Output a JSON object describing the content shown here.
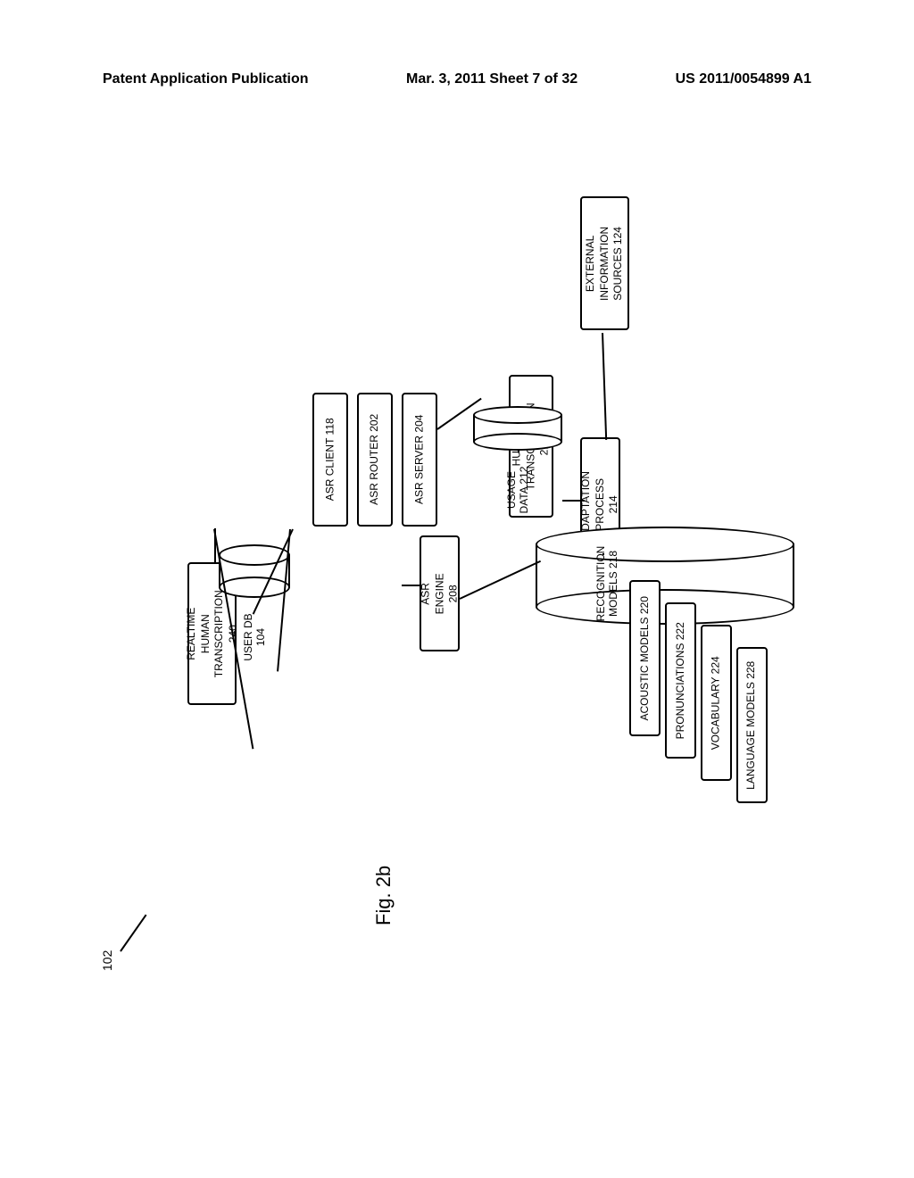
{
  "header": {
    "left": "Patent Application Publication",
    "center": "Mar. 3, 2011  Sheet 7 of 32",
    "right": "US 2011/0054899 A1"
  },
  "figure_label": "Fig. 2b",
  "ref_number": "102",
  "boxes": {
    "asr_client": "ASR CLIENT  118",
    "asr_router": "ASR ROUTER  202",
    "asr_server": "ASR SERVER  204",
    "asr_engine_line1": "ASR ENGINE",
    "asr_engine_line2": "208",
    "human_trans_line1": "HUMAN",
    "human_trans_line2": "TRANSCRIPTION",
    "human_trans_line3": "210",
    "ext_info_line1": "EXTERNAL",
    "ext_info_line2": "INFORMATION",
    "ext_info_line3": "SOURCES 124",
    "adapt_line1": "ADAPTATION",
    "adapt_line2": "PROCESS  214",
    "realtime_line1": "REALTIME HUMAN",
    "realtime_line2": "TRANSCRIPTION",
    "realtime_line3": "240",
    "acoustic": "ACOUSTIC MODELS 220",
    "pronun": "PRONUNCIATIONS  222",
    "vocab": "VOCABULARY 224",
    "lang_models": "LANGUAGE MODELS 228"
  },
  "cylinders": {
    "user_db_line1": "USER DB",
    "user_db_line2": "104",
    "usage_line1": "USAGE",
    "usage_line2": "DATA  212",
    "recog_line1": "RECOGNITION",
    "recog_line2": "MODELS  218"
  }
}
